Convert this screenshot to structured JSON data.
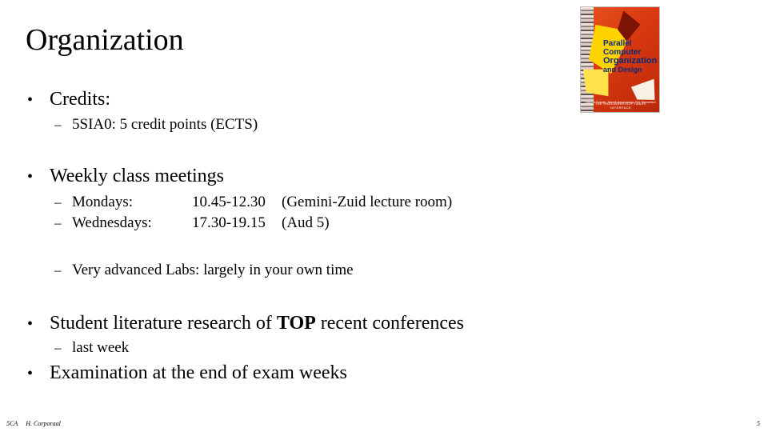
{
  "slide": {
    "title": "Organization",
    "bullets": {
      "credits_label": "Credits:",
      "credits_detail_marker": "–",
      "credits_detail": "5SIA0: 5 credit points (ECTS)",
      "weekly_label": "Weekly class meetings",
      "meetings": [
        {
          "marker": "–",
          "day": "Mondays:",
          "time": "10.45-12.30",
          "place": "(Gemini-Zuid lecture room)"
        },
        {
          "marker": "–",
          "day": "Wednesdays:",
          "time": "17.30-19.15",
          "place": "(Aud 5)"
        }
      ],
      "labs_marker": "–",
      "labs_text": "Very advanced Labs: largely in your own time",
      "research_prefix": "Student literature research of ",
      "research_emphasis": "TOP",
      "research_suffix": " recent conferences",
      "research_sub_marker": "–",
      "research_sub": "last week",
      "exam_text": "Examination at the end of exam weeks"
    },
    "bullet_marker_level1": "•",
    "bullet_marker_level2": "–"
  },
  "book_cover": {
    "line1": "Parallel",
    "line2": "Computer",
    "line3": "Organization",
    "line4": "and Design",
    "authors": "Michel Dubois, Murali Annavaram, Per Stenström",
    "edition": "THE HARDWARE/SOFTWARE INTERFACE"
  },
  "footer": {
    "left_code": "5CA",
    "left_author": "H. Corporaal",
    "page_number": "5"
  }
}
